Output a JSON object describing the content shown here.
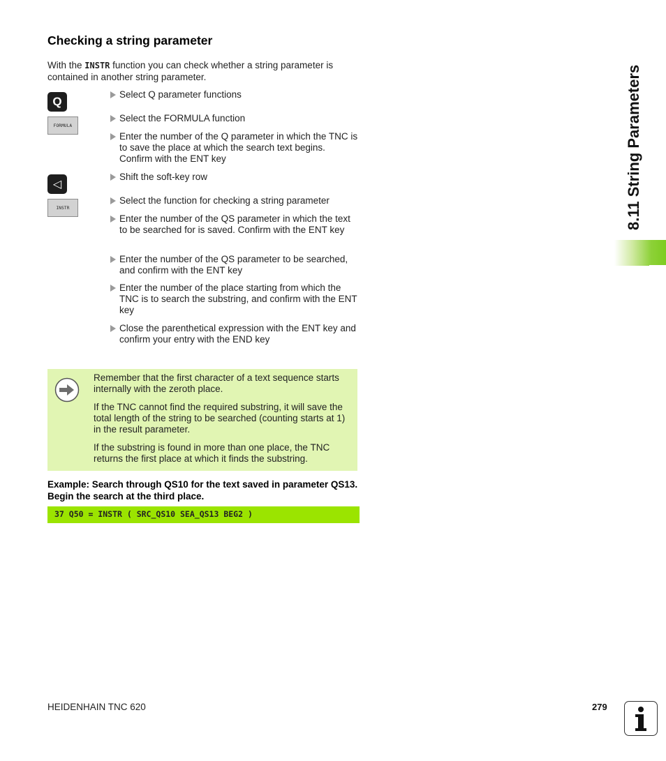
{
  "section": {
    "title": "Checking a string parameter",
    "intro_before": "With the ",
    "intro_code": "INSTR",
    "intro_after": " function you can check whether a string parameter is contained in another string parameter."
  },
  "keys": {
    "q_key": "Q",
    "formula_softkey": "FORMULA",
    "shift_key": "◁",
    "instr_softkey": "INSTR"
  },
  "steps": [
    "Select Q parameter functions",
    "Select the FORMULA function",
    "Enter the number of the Q parameter in which the TNC is to save the place at which the search text begins. Confirm with the ENT key",
    "Shift the soft-key row",
    "Select the function for checking a string parameter",
    "Enter the number of the QS parameter in which the text to be searched for is saved. Confirm with the ENT key",
    "Enter the number of the QS parameter to be searched, and confirm with the ENT key",
    "Enter the number of the place starting from which the TNC is to search the substring, and confirm with the ENT key",
    "Close the parenthetical expression with the ENT key and confirm your entry with the END key"
  ],
  "note": {
    "icon": "arrow-right-icon",
    "paragraphs": [
      "Remember that the first character of a text sequence starts internally with the zeroth place.",
      "If the TNC cannot find the required substring, it will save the total length of the string to be searched (counting starts at 1) in the result parameter.",
      "If the substring is found in more than one place, the TNC returns the first place at which it finds the substring."
    ]
  },
  "example": {
    "heading": "Example: Search through QS10 for the text saved in parameter QS13. Begin the search at the third place.",
    "code": "37 Q50 = INSTR ( SRC_QS10 SEA_QS13 BEG2 )"
  },
  "sidebar": {
    "chapter_title": "8.11 String Parameters"
  },
  "footer": {
    "brand": "HEIDENHAIN TNC 620",
    "page_number": "279",
    "info_icon": "info-icon"
  },
  "colors": {
    "note_background": "#e1f5b3",
    "code_background": "#9be400",
    "tab_accent": "#7dcc1f"
  }
}
